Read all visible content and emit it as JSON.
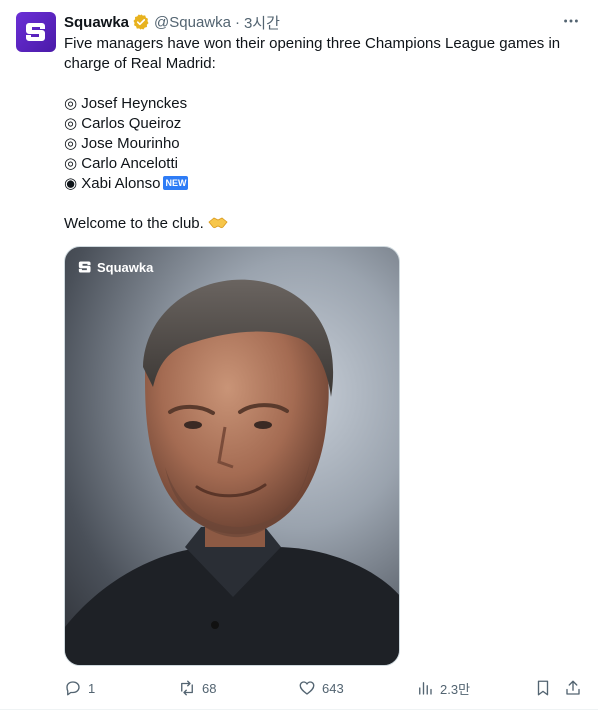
{
  "author": {
    "display_name": "Squawka",
    "handle": "@Squawka",
    "separator": "·",
    "time": "3시간",
    "avatar_icon": "squawka-logo",
    "verified_icon": "gold-verified-badge"
  },
  "tweet": {
    "lines": [
      "Five managers have won their opening three Champions League games in",
      "charge of Real Madrid:",
      "",
      "◎ Josef Heynckes",
      "◎ Carlos Queiroz",
      "◎ Jose Mourinho",
      "◎ Carlo Ancelotti",
      "◉ Xabi Alonso",
      "",
      "Welcome to the club."
    ],
    "new_badge": "NEW"
  },
  "media": {
    "watermark": "Squawka"
  },
  "actions": {
    "replies": "1",
    "retweets": "68",
    "likes": "643",
    "views": "2.3만"
  },
  "colors": {
    "accent": "#1d9bf0",
    "muted": "#536471",
    "brand": "#5b24c4"
  }
}
